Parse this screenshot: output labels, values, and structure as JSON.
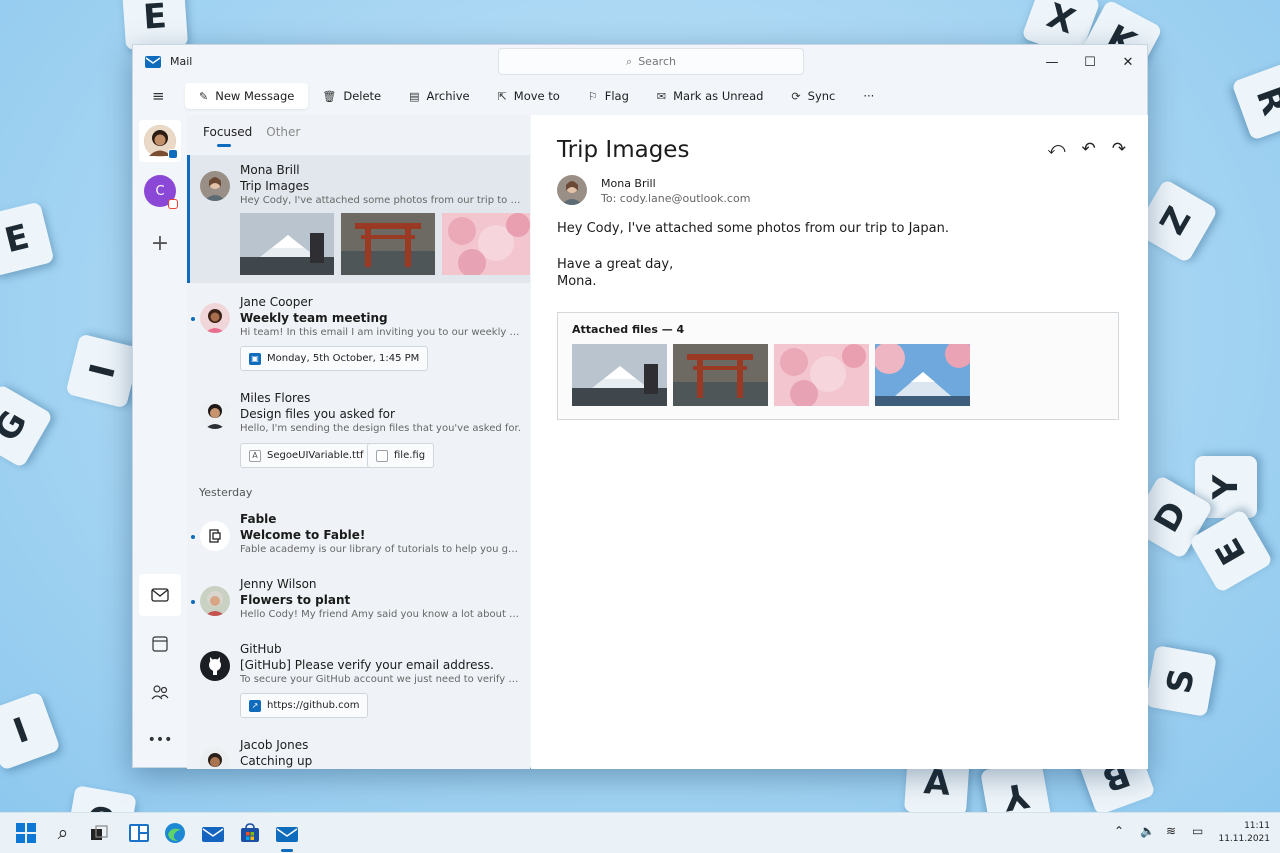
{
  "app": {
    "title": "Mail"
  },
  "search": {
    "placeholder": "Search"
  },
  "toolbar": {
    "new_message": "New Message",
    "delete": "Delete",
    "archive": "Archive",
    "move_to": "Move to",
    "flag": "Flag",
    "mark_unread": "Mark as Unread",
    "sync": "Sync",
    "more": "···"
  },
  "accounts": {
    "second_initial": "C"
  },
  "tabs": {
    "focused": "Focused",
    "other": "Other"
  },
  "messages": [
    {
      "sender": "Mona Brill",
      "subject": "Trip Images",
      "preview": "Hey Cody, I've attached some photos from our trip to Japan."
    },
    {
      "sender": "Jane Cooper",
      "subject": "Weekly team meeting",
      "preview": "Hi team! In this email I am inviting you to our weekly meeting",
      "chip": "Monday, 5th October, 1:45 PM"
    },
    {
      "sender": "Miles Flores",
      "subject": "Design files you asked for",
      "preview": "Hello, I'm sending the design files that you've asked for.",
      "chips": [
        "SegoeUIVariable.ttf",
        "file.fig"
      ]
    },
    {
      "sender": "Fable",
      "subject": "Welcome to Fable!",
      "preview": "Fable academy is our library of tutorials to help you get the ..."
    },
    {
      "sender": "Jenny Wilson",
      "subject": "Flowers to plant",
      "preview": "Hello Cody! My friend Amy said you know a lot about flowers"
    },
    {
      "sender": "GitHub",
      "subject": "[GitHub] Please verify your email address.",
      "preview": "To secure your GitHub account we just need to verify your ...",
      "chip": "https://github.com"
    },
    {
      "sender": "Jacob Jones",
      "subject": "Catching up"
    }
  ],
  "section_yesterday": "Yesterday",
  "reading": {
    "subject": "Trip Images",
    "from": "Mona Brill",
    "to": "To: cody.lane@outlook.com",
    "body_1": "Hey Cody, I've attached some photos from our trip to Japan.",
    "body_2": "Have a great day,",
    "body_3": "Mona.",
    "attachments_title": "Attached files — 4"
  },
  "tray": {
    "time": "11:11",
    "date": "11.11.2021"
  },
  "colors": {
    "accent": "#0f6cbd"
  }
}
